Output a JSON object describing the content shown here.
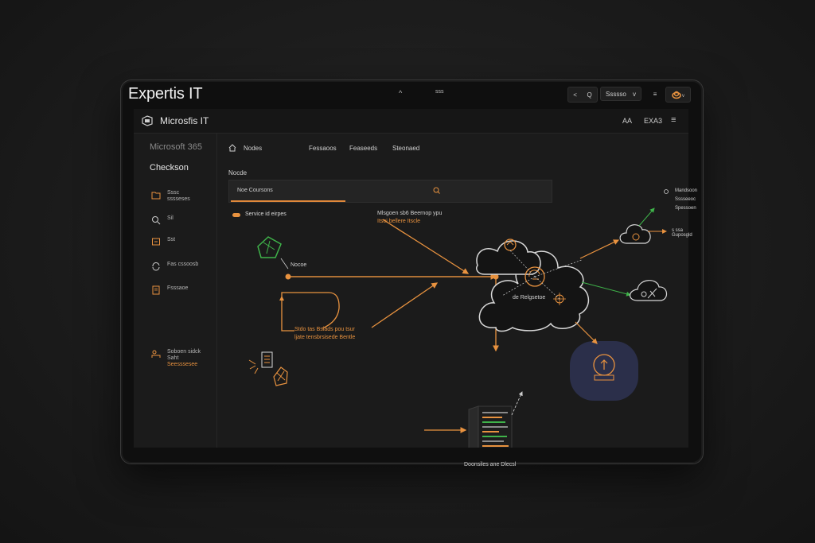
{
  "topbar": {
    "brand": "Expertis IT",
    "mid_icon": "^",
    "mid_label": "sss",
    "btn_back": "<",
    "btn_search": "Q",
    "dropdown_label": "Ssssso",
    "dropdown_caret": "v",
    "btn_menu": "≡"
  },
  "app": {
    "title": "Microsfis IT",
    "right_icon": "AA",
    "right_label": "EXA3",
    "menu_icon": "≡"
  },
  "sidebar": {
    "subtitle": "Microsoft 365",
    "heading": "Checkson",
    "items": [
      {
        "icon": "folder-icon",
        "line1": "Sssc",
        "line2": "sssseses"
      },
      {
        "icon": "search-icon",
        "line1": "Sil",
        "line2": ""
      },
      {
        "icon": "box-icon",
        "line1": "Sst",
        "line2": ""
      },
      {
        "icon": "sync-icon",
        "line1": "Fas cssoosb",
        "line2": ""
      },
      {
        "icon": "document-icon",
        "line1": "Fsssaoe",
        "line2": ""
      }
    ],
    "footer": {
      "icon": "person-icon",
      "line1": "Soboen sidck",
      "line2a": "Saht",
      "line2b": "Seesssesee"
    }
  },
  "tabs": [
    "Nodes",
    "Fessaoos",
    "Feaseeds",
    "Steonaed"
  ],
  "section_label": "Nocde",
  "search": {
    "value": "Noe Coursons",
    "icon": "search-icon"
  },
  "diagram": {
    "service_label": "Service id eirpes",
    "flow_label_1": "Mlsgoen sb6 Beernop ypu",
    "flow_label_2": "Itsoi bellere Itscle",
    "node_label_1": "Nocoe",
    "cloud_label": "de Relgsetoe",
    "annot_1": "Stdo tas Bsiads pou tsur",
    "annot_2": "ljate tensbrsisede Bentle",
    "server_label": "Doonsiles ane Dlecsl",
    "right_item_1": "Mandsoon",
    "right_item_2": "Sssseeoc",
    "right_item_3": "Spessoen",
    "right_item_4": "s ssa Guposgld",
    "colors": {
      "accent": "#e8923f",
      "green": "#3fb34a",
      "badge": "#2b2f4a"
    }
  }
}
